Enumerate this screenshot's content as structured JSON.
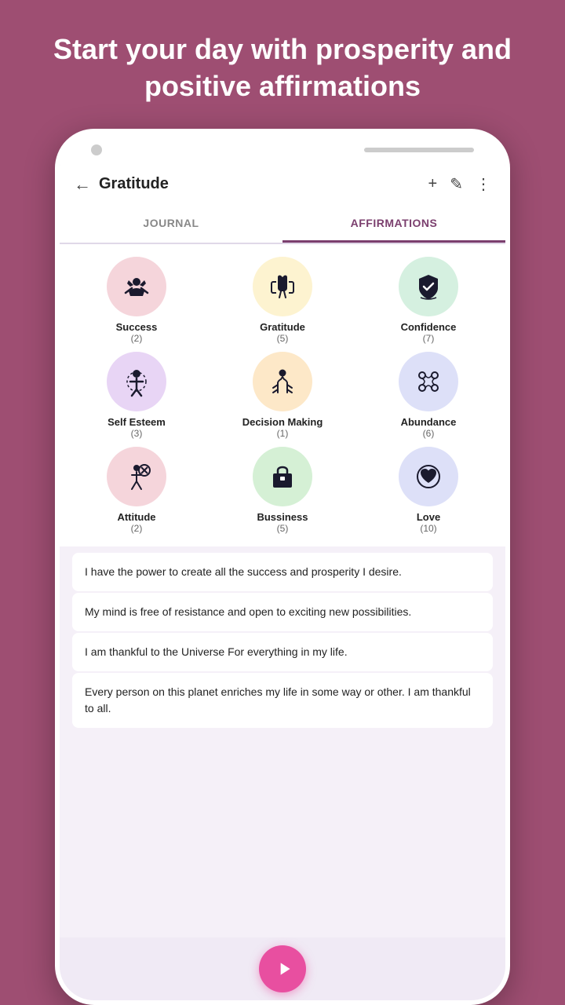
{
  "hero": {
    "title": "Start your day with prosperity and positive affirmations"
  },
  "app": {
    "header": {
      "back_label": "←",
      "title": "Gratitude",
      "icon_add": "+",
      "icon_edit": "✎",
      "icon_more": "⋮"
    },
    "tabs": [
      {
        "id": "journal",
        "label": "JOURNAL",
        "active": false
      },
      {
        "id": "affirmations",
        "label": "AFFIRMATIONS",
        "active": true
      }
    ],
    "categories": [
      {
        "id": "success",
        "name": "Success",
        "count": "(2)",
        "bg": "#f5d5db",
        "icon": "crown"
      },
      {
        "id": "gratitude",
        "name": "Gratitude",
        "count": "(5)",
        "bg": "#fdf3d0",
        "icon": "hands"
      },
      {
        "id": "confidence",
        "name": "Confidence",
        "count": "(7)",
        "bg": "#d5f0e0",
        "icon": "shield"
      },
      {
        "id": "self-esteem",
        "name": "Self Esteem",
        "count": "(3)",
        "bg": "#e8d5f5",
        "icon": "person"
      },
      {
        "id": "decision-making",
        "name": "Decision Making",
        "count": "(1)",
        "bg": "#fde8c8",
        "icon": "lotus"
      },
      {
        "id": "abundance",
        "name": "Abundance",
        "count": "(6)",
        "bg": "#dde0f8",
        "icon": "butterfly"
      },
      {
        "id": "attitude",
        "name": "Attitude",
        "count": "(2)",
        "bg": "#f5d5db",
        "icon": "target"
      },
      {
        "id": "business",
        "name": "Bussiness",
        "count": "(5)",
        "bg": "#d5f0d5",
        "icon": "briefcase"
      },
      {
        "id": "love",
        "name": "Love",
        "count": "(10)",
        "bg": "#dde0f8",
        "icon": "heart"
      }
    ],
    "affirmations": [
      "I have the power to create all the success and prosperity I desire.",
      "My mind is free of resistance and open to exciting new possibilities.",
      "I am thankful to the Universe For everything in my life.",
      "Every person on this planet enriches my life in some way or other. I am thankful to all."
    ]
  }
}
